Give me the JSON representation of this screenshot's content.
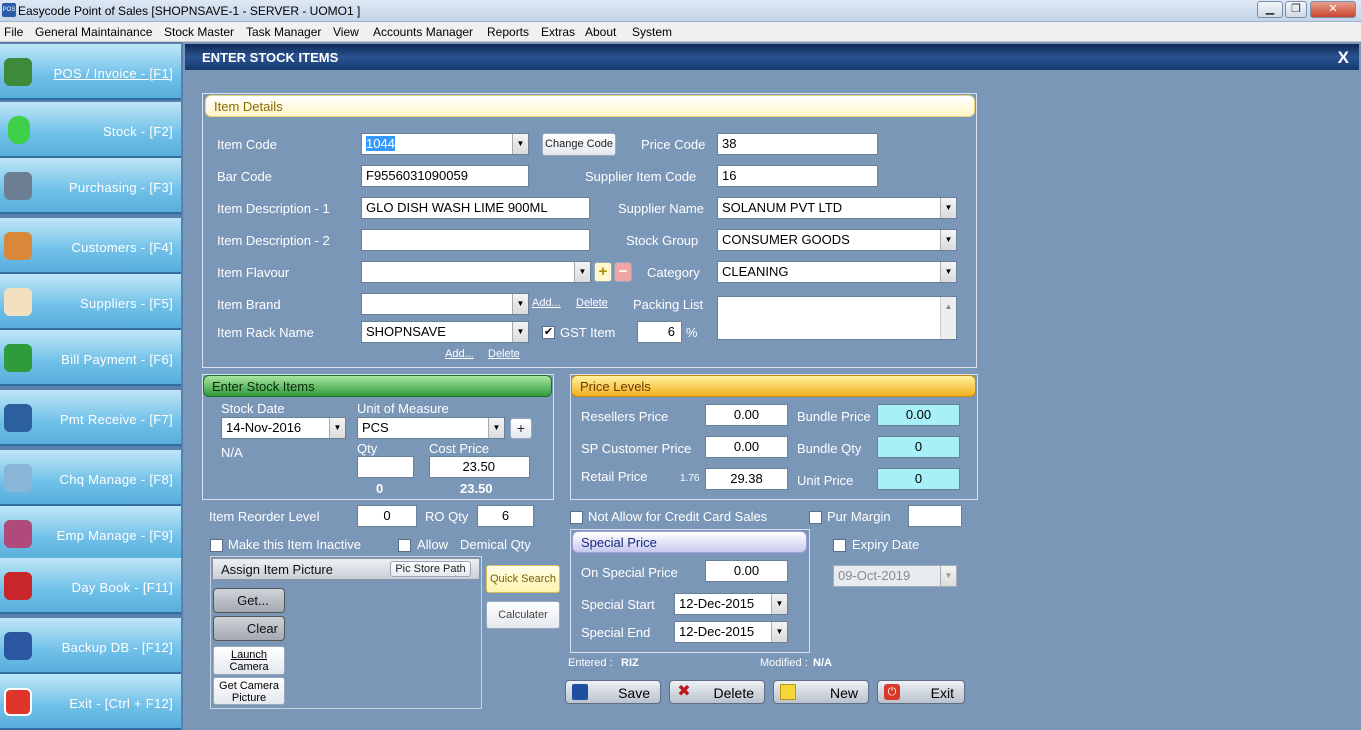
{
  "window": {
    "title": "Easycode Point of Sales [SHOPNSAVE-1 - SERVER - UOMO1 ]",
    "app_icon": "POS"
  },
  "menu": [
    "File",
    "General Maintainance",
    "Stock Master",
    "Task Manager",
    "View",
    "Accounts Manager",
    "Reports",
    "Extras",
    "About",
    "System"
  ],
  "sidebar": [
    {
      "label": "POS / Invoice - [F1]",
      "icon": "pos-icon"
    },
    {
      "label": "Stock - [F2]",
      "icon": "stock-icon"
    },
    {
      "label": "Purchasing - [F3]",
      "icon": "cart-icon"
    },
    {
      "label": "Customers - [F4]",
      "icon": "customers-icon"
    },
    {
      "label": "Suppliers - [F5]",
      "icon": "supplier-icon"
    },
    {
      "label": "Bill Payment - [F6]",
      "icon": "dollar-icon"
    },
    {
      "label": "Pmt Receive - [F7]",
      "icon": "card-icon"
    },
    {
      "label": "Chq Manage - [F8]",
      "icon": "cheque-icon"
    },
    {
      "label": "Emp Manage - [F9]",
      "icon": "employee-icon"
    },
    {
      "label": "Day Book - [F11]",
      "icon": "book-icon"
    },
    {
      "label": "Backup DB - [F12]",
      "icon": "floppy-icon"
    },
    {
      "label": "Exit - [Ctrl + F12]",
      "icon": "power-icon"
    }
  ],
  "header": {
    "title": "ENTER STOCK ITEMS",
    "close": "X"
  },
  "item": {
    "panel_title": "Item Details",
    "code_label": "Item Code",
    "code": "1044",
    "change_code": "Change Code",
    "price_code_label": "Price Code",
    "price_code": "38",
    "bar_code_label": "Bar Code",
    "bar_code": "F9556031090059",
    "supplier_item_code_label": "Supplier Item Code",
    "supplier_item_code": "16",
    "desc1_label": "Item Description - 1",
    "desc1": "GLO DISH WASH LIME 900ML",
    "supplier_name_label": "Supplier Name",
    "supplier_name": "SOLANUM PVT LTD",
    "desc2_label": "Item Description - 2",
    "desc2": "",
    "stock_group_label": "Stock Group",
    "stock_group": "CONSUMER GOODS",
    "flavour_label": "Item Flavour",
    "flavour": "",
    "category_label": "Category",
    "category": "CLEANING",
    "brand_label": "Item Brand",
    "brand": "",
    "add": "Add...",
    "delete": "Delete",
    "packing_list_label": "Packing List",
    "rack_label": "Item Rack Name",
    "rack": "SHOPNSAVE",
    "gst_label": "GST Item",
    "gst": "6",
    "percent": "%"
  },
  "stock": {
    "panel_title": "Enter Stock Items",
    "date_label": "Stock Date",
    "date": "14-Nov-2016",
    "uom_label": "Unit of Measure",
    "uom": "PCS",
    "plus": "+",
    "na": "N/A",
    "qty_label": "Qty",
    "qty": "",
    "cost_label": "Cost Price",
    "cost": "23.50",
    "qty_total": "0",
    "cost_total": "23.50"
  },
  "price": {
    "panel_title": "Price Levels",
    "resellers_label": "Resellers Price",
    "resellers": "0.00",
    "bundle_price_label": "Bundle Price",
    "bundle_price": "0.00",
    "sp_customer_label": "SP Customer Price",
    "sp_customer": "0.00",
    "bundle_qty_label": "Bundle Qty",
    "bundle_qty": "0",
    "retail_label": "Retail Price",
    "retail_markup": "1.76",
    "retail": "29.38",
    "unit_price_label": "Unit Price",
    "unit_price": "0"
  },
  "reorder": {
    "label": "Item Reorder Level",
    "value": "0",
    "ro_label": "RO Qty",
    "ro_value": "6"
  },
  "options": {
    "inactive": "Make this Item Inactive",
    "allow": "Allow",
    "decimal": "Demical Qty",
    "no_credit": "Not Allow for Credit Card Sales",
    "pur_margin": "Pur Margin",
    "pur_margin_value": "",
    "expiry_label": "Expiry Date",
    "expiry": "09-Oct-2019"
  },
  "picture": {
    "title": "Assign Item Picture",
    "store_path": "Pic Store Path",
    "get": "Get...",
    "clear": "Clear",
    "launch1": "Launch",
    "launch2": "Camera",
    "getcam1": "Get Camera",
    "getcam2": "Picture"
  },
  "tools": {
    "quick_search": "Quick Search",
    "calculator": "Calculater"
  },
  "special": {
    "panel_title": "Special Price",
    "on_label": "On Special Price",
    "on": "0.00",
    "start_label": "Special Start",
    "start": "12-Dec-2015",
    "end_label": "Special End",
    "end": "12-Dec-2015"
  },
  "audit": {
    "entered_label": "Entered :",
    "entered": "RIZ",
    "modified_label": "Modified :",
    "modified": "N/A"
  },
  "actions": {
    "save": "Save",
    "delete": "Delete",
    "new": "New",
    "exit": "Exit"
  }
}
